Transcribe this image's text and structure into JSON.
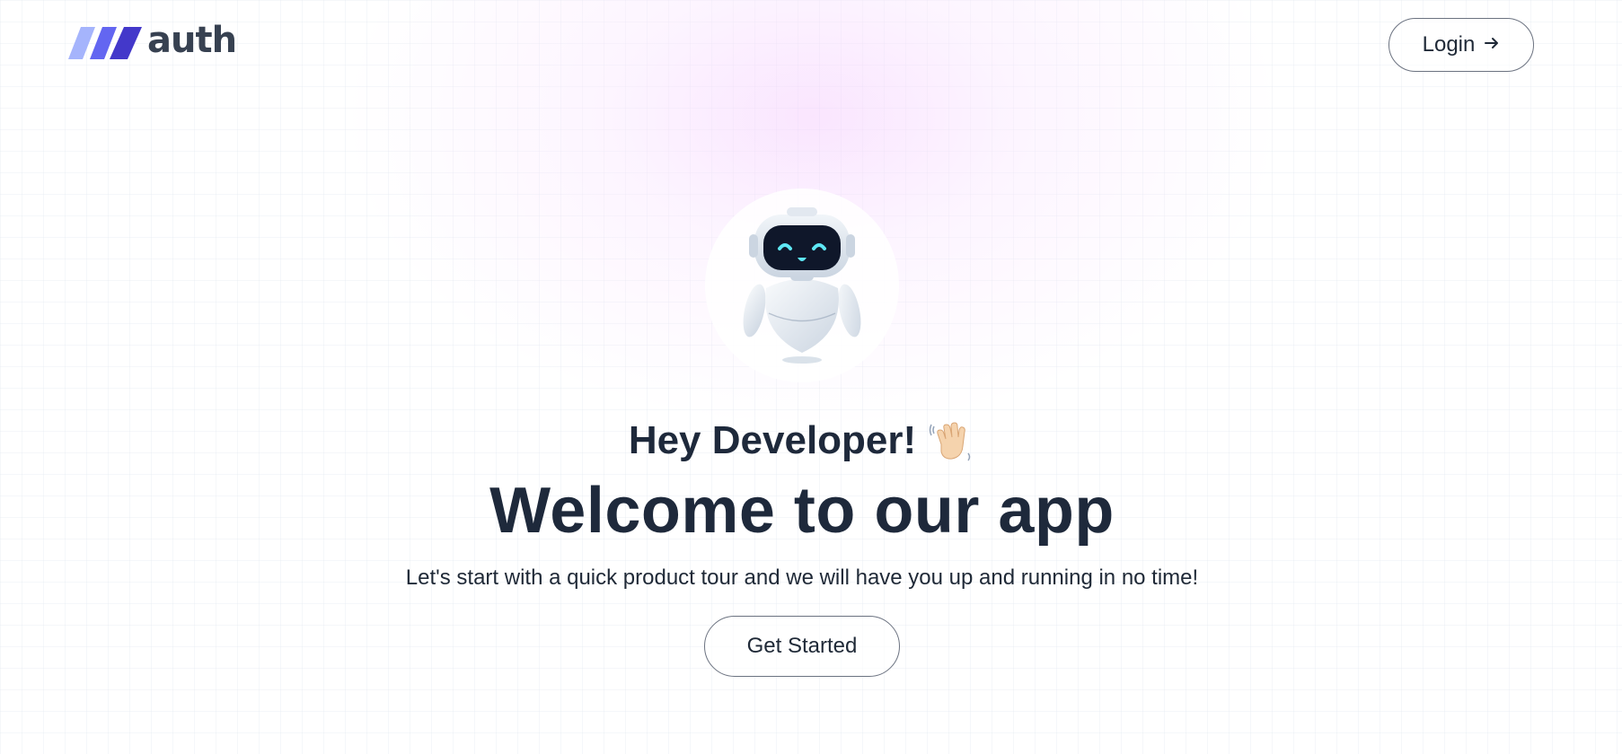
{
  "header": {
    "logo_text": "auth",
    "login_label": "Login",
    "login_icon": "arrow-right-icon"
  },
  "hero": {
    "avatar_icon": "robot-icon",
    "greeting": "Hey Developer!",
    "greeting_icon": "waving-hand-icon",
    "title": "Welcome to our app",
    "subtitle": "Let's start with a quick product tour and we will have you up and running in no time!",
    "cta_label": "Get Started"
  },
  "colors": {
    "logo_accent": "#4f46e5",
    "logo_accent_light": "#818cf8",
    "text": "#1e293b",
    "glow": "#f5d0fe",
    "robot_visor": "#0f172a",
    "robot_eyes": "#5ee7f5"
  }
}
